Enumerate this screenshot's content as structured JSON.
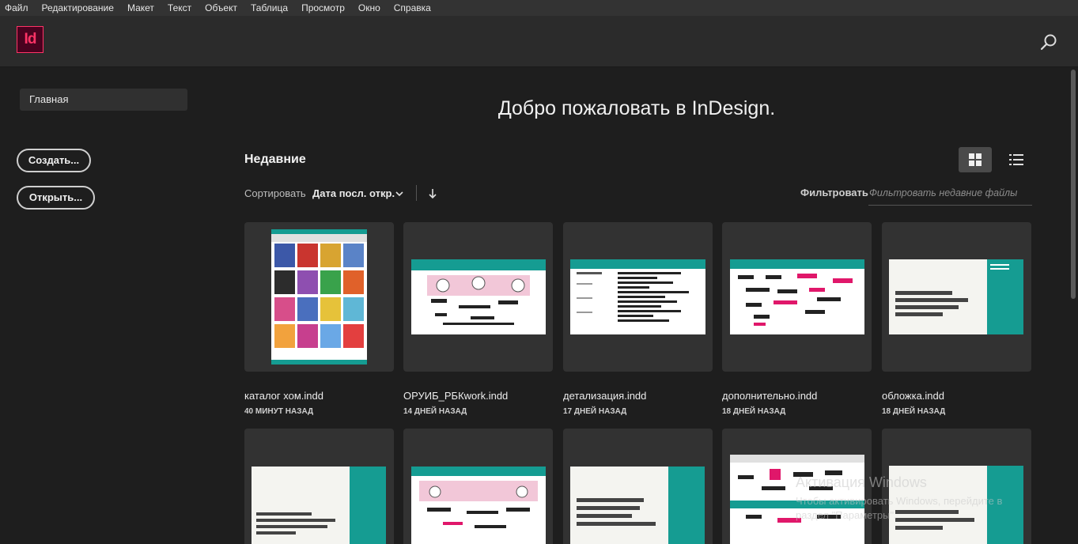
{
  "menu": [
    "Файл",
    "Редактирование",
    "Макет",
    "Текст",
    "Объект",
    "Таблица",
    "Просмотр",
    "Окно",
    "Справка"
  ],
  "app": {
    "logo_text": "Id",
    "logo_color": "#ff3366",
    "logo_bg": "#49021f"
  },
  "sidebar": {
    "home_label": "Главная",
    "create_label": "Создать...",
    "open_label": "Открыть..."
  },
  "main": {
    "welcome": "Добро пожаловать в InDesign.",
    "recent_title": "Недавние",
    "sort_label": "Сортировать",
    "sort_value": "Дата посл. откр.",
    "filter_label": "Фильтровать",
    "filter_placeholder": "Фильтровать недавние файлы"
  },
  "files": [
    {
      "name": "каталог хом.indd",
      "time": "40 МИНУТ НАЗАД"
    },
    {
      "name": "ОРУИБ_РБКwork.indd",
      "time": "14 ДНЕЙ НАЗАД"
    },
    {
      "name": "детализация.indd",
      "time": "17 ДНЕЙ НАЗАД"
    },
    {
      "name": "дополнительно.indd",
      "time": "18 ДНЕЙ НАЗАД"
    },
    {
      "name": "обложка.indd",
      "time": "18 ДНЕЙ НАЗАД"
    },
    {
      "name": "",
      "time": ""
    },
    {
      "name": "",
      "time": ""
    },
    {
      "name": "",
      "time": ""
    },
    {
      "name": "",
      "time": ""
    },
    {
      "name": "",
      "time": ""
    }
  ],
  "watermark": {
    "title": "Активация Windows",
    "line1": "Чтобы активировать Windows, перейдите в",
    "line2": "раздел \"Параметры\"."
  },
  "colors": {
    "teal": "#159c92",
    "pink": "#e0176a",
    "background": "#1e1e1e",
    "card": "#323232"
  },
  "icons": {
    "search": "search-icon",
    "grid": "grid-view-icon",
    "list": "list-view-icon",
    "sort": "chevron-down-icon",
    "direction": "arrow-down-icon"
  }
}
